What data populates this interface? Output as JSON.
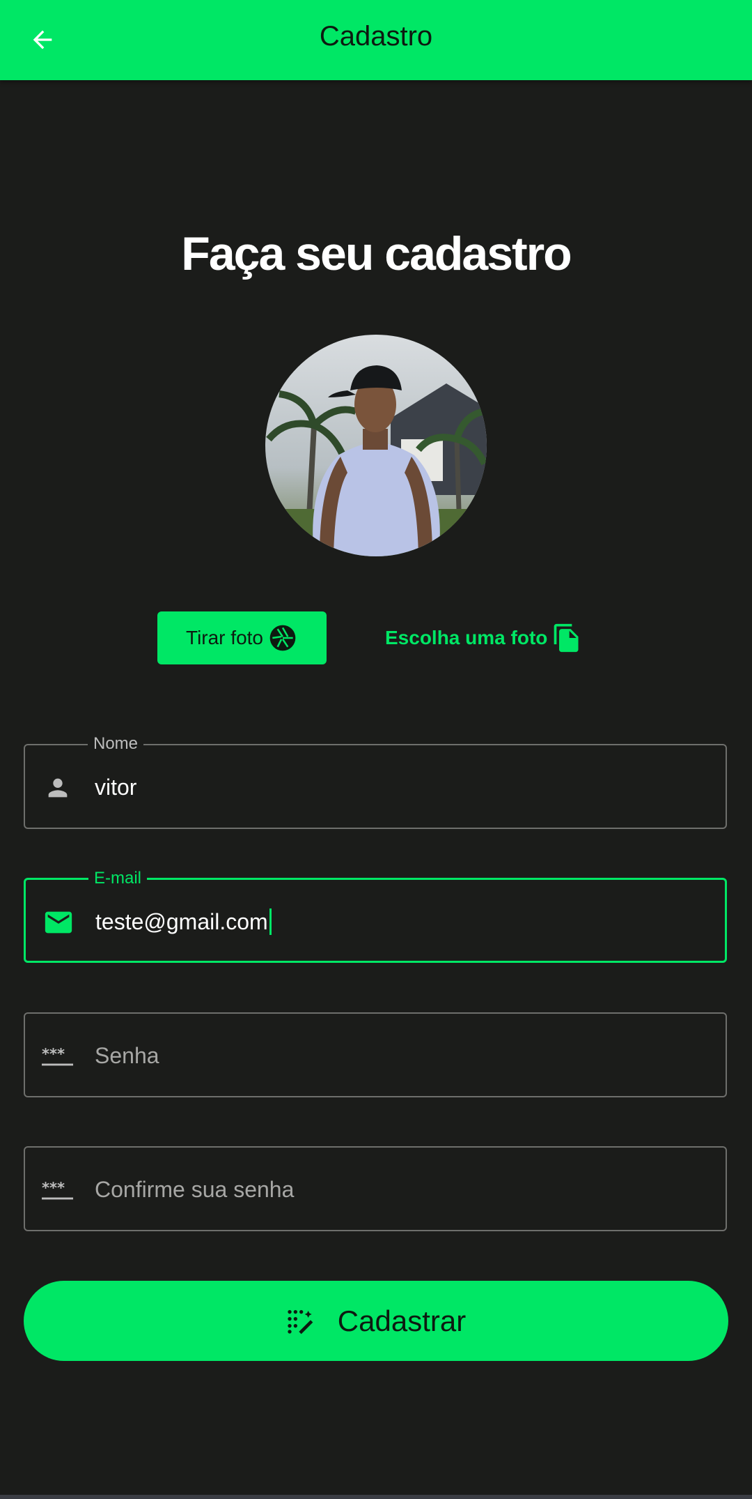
{
  "colors": {
    "accent": "#00e765",
    "background": "#1b1c1a",
    "border": "#6e6f6c",
    "text": "#ffffff",
    "placeholder": "#a7a7a5"
  },
  "appbar": {
    "title": "Cadastro",
    "back_icon": "arrow-left-icon"
  },
  "heading": "Faça seu cadastro",
  "avatar": {
    "icon": "profile-photo"
  },
  "photo_buttons": {
    "take_label": "Tirar foto",
    "take_icon": "camera-aperture-icon",
    "choose_label": "Escolha uma foto",
    "choose_icon": "file-copy-icon"
  },
  "fields": {
    "name": {
      "label": "Nome",
      "value": "vitor",
      "icon": "person-icon"
    },
    "email": {
      "label": "E-mail",
      "value": "teste@gmail.com",
      "icon": "mail-icon"
    },
    "password": {
      "placeholder": "Senha",
      "icon": "password-icon"
    },
    "confirm": {
      "placeholder": "Confirme sua senha",
      "icon": "password-icon"
    }
  },
  "submit": {
    "label": "Cadastrar",
    "icon": "magic-wand-icon"
  }
}
